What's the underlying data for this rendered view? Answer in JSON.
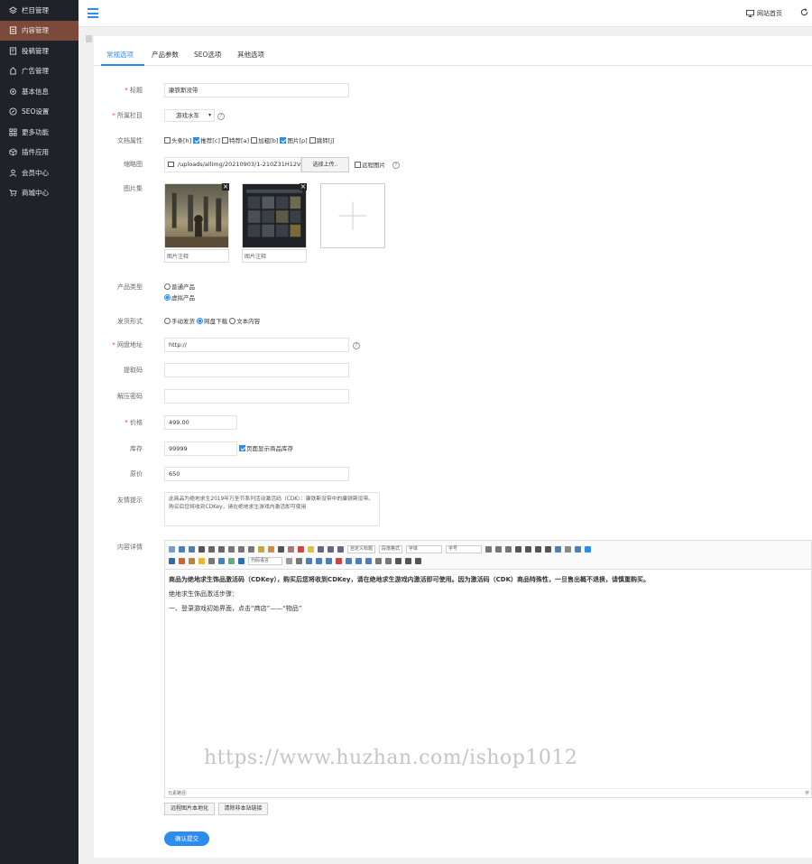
{
  "sidebar": {
    "items": [
      {
        "label": "栏目管理",
        "icon": "layers-icon",
        "active": false
      },
      {
        "label": "内容管理",
        "icon": "document-icon",
        "active": true
      },
      {
        "label": "投稿管理",
        "icon": "edit-doc-icon",
        "active": false
      },
      {
        "label": "广告管理",
        "icon": "ad-icon",
        "active": false
      },
      {
        "label": "基本信息",
        "icon": "gear-icon",
        "active": false
      },
      {
        "label": "SEO设置",
        "icon": "compass-icon",
        "active": false
      },
      {
        "label": "更多功能",
        "icon": "grid-icon",
        "active": false
      },
      {
        "label": "插件应用",
        "icon": "cube-icon",
        "active": false
      },
      {
        "label": "会员中心",
        "icon": "user-icon",
        "active": false
      },
      {
        "label": "商城中心",
        "icon": "cart-icon",
        "active": false
      }
    ]
  },
  "topbar": {
    "home_label": "网站首页"
  },
  "tabs": [
    "常规选项",
    "产品参数",
    "SEO选项",
    "其他选项"
  ],
  "form": {
    "title": {
      "label": "标题",
      "value": "康铁斯没带"
    },
    "column": {
      "label": "所属栏目",
      "value": "游戏水车"
    },
    "attr": {
      "label": "文档属性",
      "options": [
        {
          "label": "头条[h]",
          "checked": false
        },
        {
          "label": "推荐[c]",
          "checked": true
        },
        {
          "label": "特荐[a]",
          "checked": false
        },
        {
          "label": "加粗[b]",
          "checked": false
        },
        {
          "label": "图片[p]",
          "checked": true
        },
        {
          "label": "跳转[j]",
          "checked": false
        }
      ]
    },
    "thumb": {
      "label": "缩略图",
      "path": "/uploads/allimg/20210903/1-210Z31H12V",
      "button": "选择上传..",
      "remote_label": "远程图片"
    },
    "gallery": {
      "label": "图片集",
      "captions": [
        "图片注释",
        "图片注释"
      ]
    },
    "product_type": {
      "label": "产品类型",
      "options": [
        {
          "label": "普通产品",
          "checked": false
        },
        {
          "label": "虚拟产品",
          "checked": true
        }
      ]
    },
    "delivery": {
      "label": "发货形式",
      "options": [
        {
          "label": "手动发货",
          "checked": false
        },
        {
          "label": "网盘下载",
          "checked": true
        },
        {
          "label": "文本内容",
          "checked": false
        }
      ]
    },
    "netdisk": {
      "label": "网盘地址",
      "value": "http://"
    },
    "extract_code": {
      "label": "提取码",
      "value": ""
    },
    "unzip_pwd": {
      "label": "解压密码",
      "value": ""
    },
    "price": {
      "label": "价格",
      "value": "499.00"
    },
    "stock": {
      "label": "库存",
      "value": "99999",
      "show_label": "页面显示商品库存",
      "show_checked": true
    },
    "original_price": {
      "label": "原价",
      "value": "650"
    },
    "friendly_tip": {
      "label": "友情提示",
      "value": "此商品为绝地求生2019年万圣节系列活动激活码（CDK）：康铁斯没带中的康铁斯没带。购买后您将收到CDKey，请在绝地求生游戏内激活即可使用"
    },
    "content": {
      "label": "内容详情",
      "toolbar_selects": [
        "自定义标题",
        "段落格式",
        "字体",
        "字号",
        "代码语言"
      ],
      "lines": [
        "商品为绝地求生饰品激活码（CDKey），购买后您将收到CDKey，请在绝地求生游戏内激活即可使用。因为激活码（CDK）商品特殊性，一旦售出概不退换，请慎重购买。",
        "绝地求生饰品激活步骤：",
        "一、登录游戏初始界面，点击“商店”——“物品”"
      ],
      "path_label": "元素路径:",
      "word_count": "字"
    },
    "btn_remote_local": "远程图片本地化",
    "btn_strip_links": "清除非本站链接",
    "submit": "确认提交"
  },
  "watermark": "https://www.huzhan.com/ishop1012",
  "colors": {
    "accent": "#2d8cf0",
    "sidebar_bg": "#20222a",
    "sidebar_active": "#7b4a3a",
    "required": "#e4393c"
  }
}
